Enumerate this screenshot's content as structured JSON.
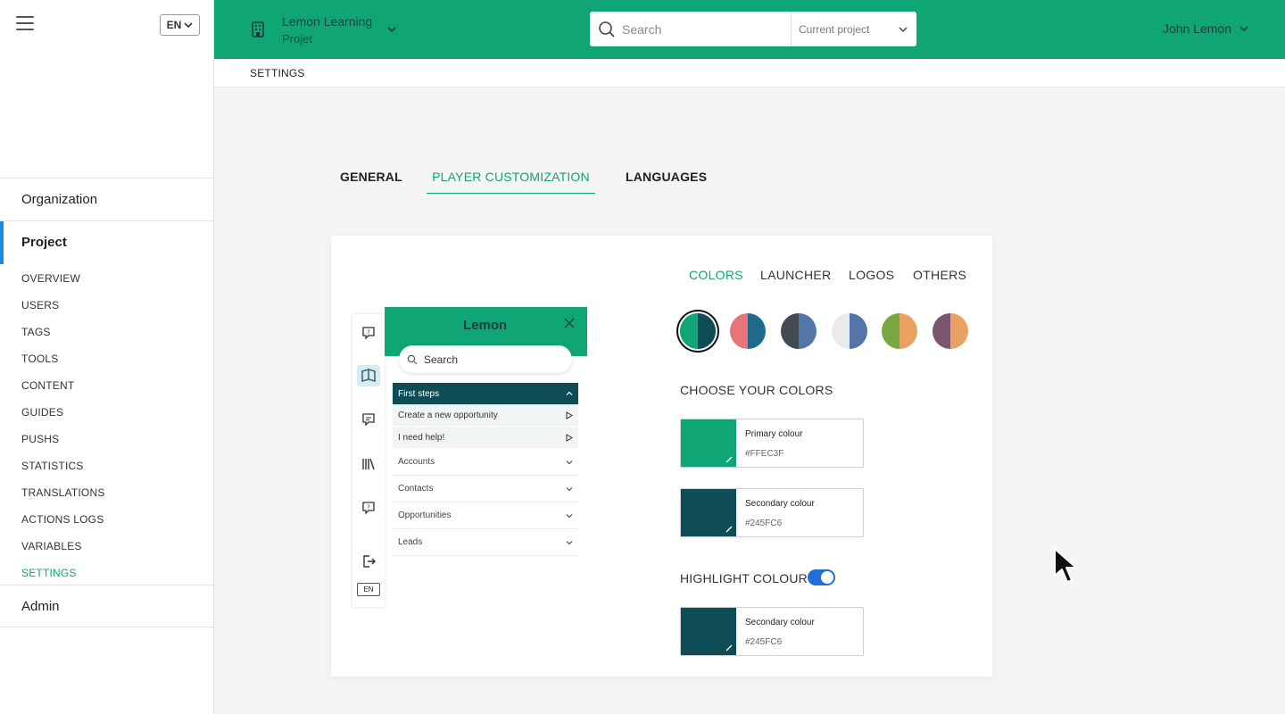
{
  "sidebar": {
    "lang": "EN",
    "sections": {
      "organization": "Organization",
      "project": "Project",
      "admin": "Admin"
    },
    "items": [
      "OVERVIEW",
      "USERS",
      "TAGS",
      "TOOLS",
      "CONTENT",
      "GUIDES",
      "PUSHS",
      "STATISTICS",
      "TRANSLATIONS",
      "ACTIONS LOGS",
      "VARIABLES",
      "SETTINGS"
    ],
    "active_item": "SETTINGS"
  },
  "topbar": {
    "project_title": "Lemon Learning",
    "project_sub": "Projet",
    "search_placeholder": "Search",
    "search_scope": "Current project",
    "user_name": "John Lemon"
  },
  "breadcrumb": "SETTINGS",
  "tabs": [
    "GENERAL",
    "PLAYER CUSTOMIZATION",
    "LANGUAGES"
  ],
  "active_tab": "PLAYER CUSTOMIZATION",
  "card": {
    "subtabs": [
      "COLORS",
      "LAUNCHER",
      "LOGOS",
      "OTHERS"
    ],
    "active_subtab": "COLORS",
    "swatches": [
      {
        "left": "#10a574",
        "right": "#0e4d55"
      },
      {
        "left": "#e8737a",
        "right": "#1e6a8a"
      },
      {
        "left": "#444a52",
        "right": "#5475a8"
      },
      {
        "left": "#e9eaec",
        "right": "#5475a8"
      },
      {
        "left": "#7aa840",
        "right": "#eaa263"
      },
      {
        "left": "#7b5470",
        "right": "#eaa263"
      }
    ],
    "choose_title": "CHOOSE YOUR COLORS",
    "primary": {
      "label": "Primary colour",
      "hex": "#FFEC3F",
      "chip": "#10a574"
    },
    "secondary": {
      "label": "Secondary colour",
      "hex": "#245FC6",
      "chip": "#0e4d55"
    },
    "highlight_title": "HIGHLIGHT COLOUR",
    "highlight_enabled": true,
    "highlight": {
      "label": "Secondary colour",
      "hex": "#245FC6",
      "chip": "#0e4d55"
    }
  },
  "preview": {
    "logo": "Lemon",
    "search": "Search",
    "lang": "EN",
    "head": "First steps",
    "sub_items": [
      "Create a new opportunity",
      "I need help!"
    ],
    "rows": [
      "Accounts",
      "Contacts",
      "Opportunities",
      "Leads"
    ]
  },
  "colors": {
    "brand": "#10a574",
    "accent": "#1e88e5",
    "dark": "#0e4d55"
  }
}
